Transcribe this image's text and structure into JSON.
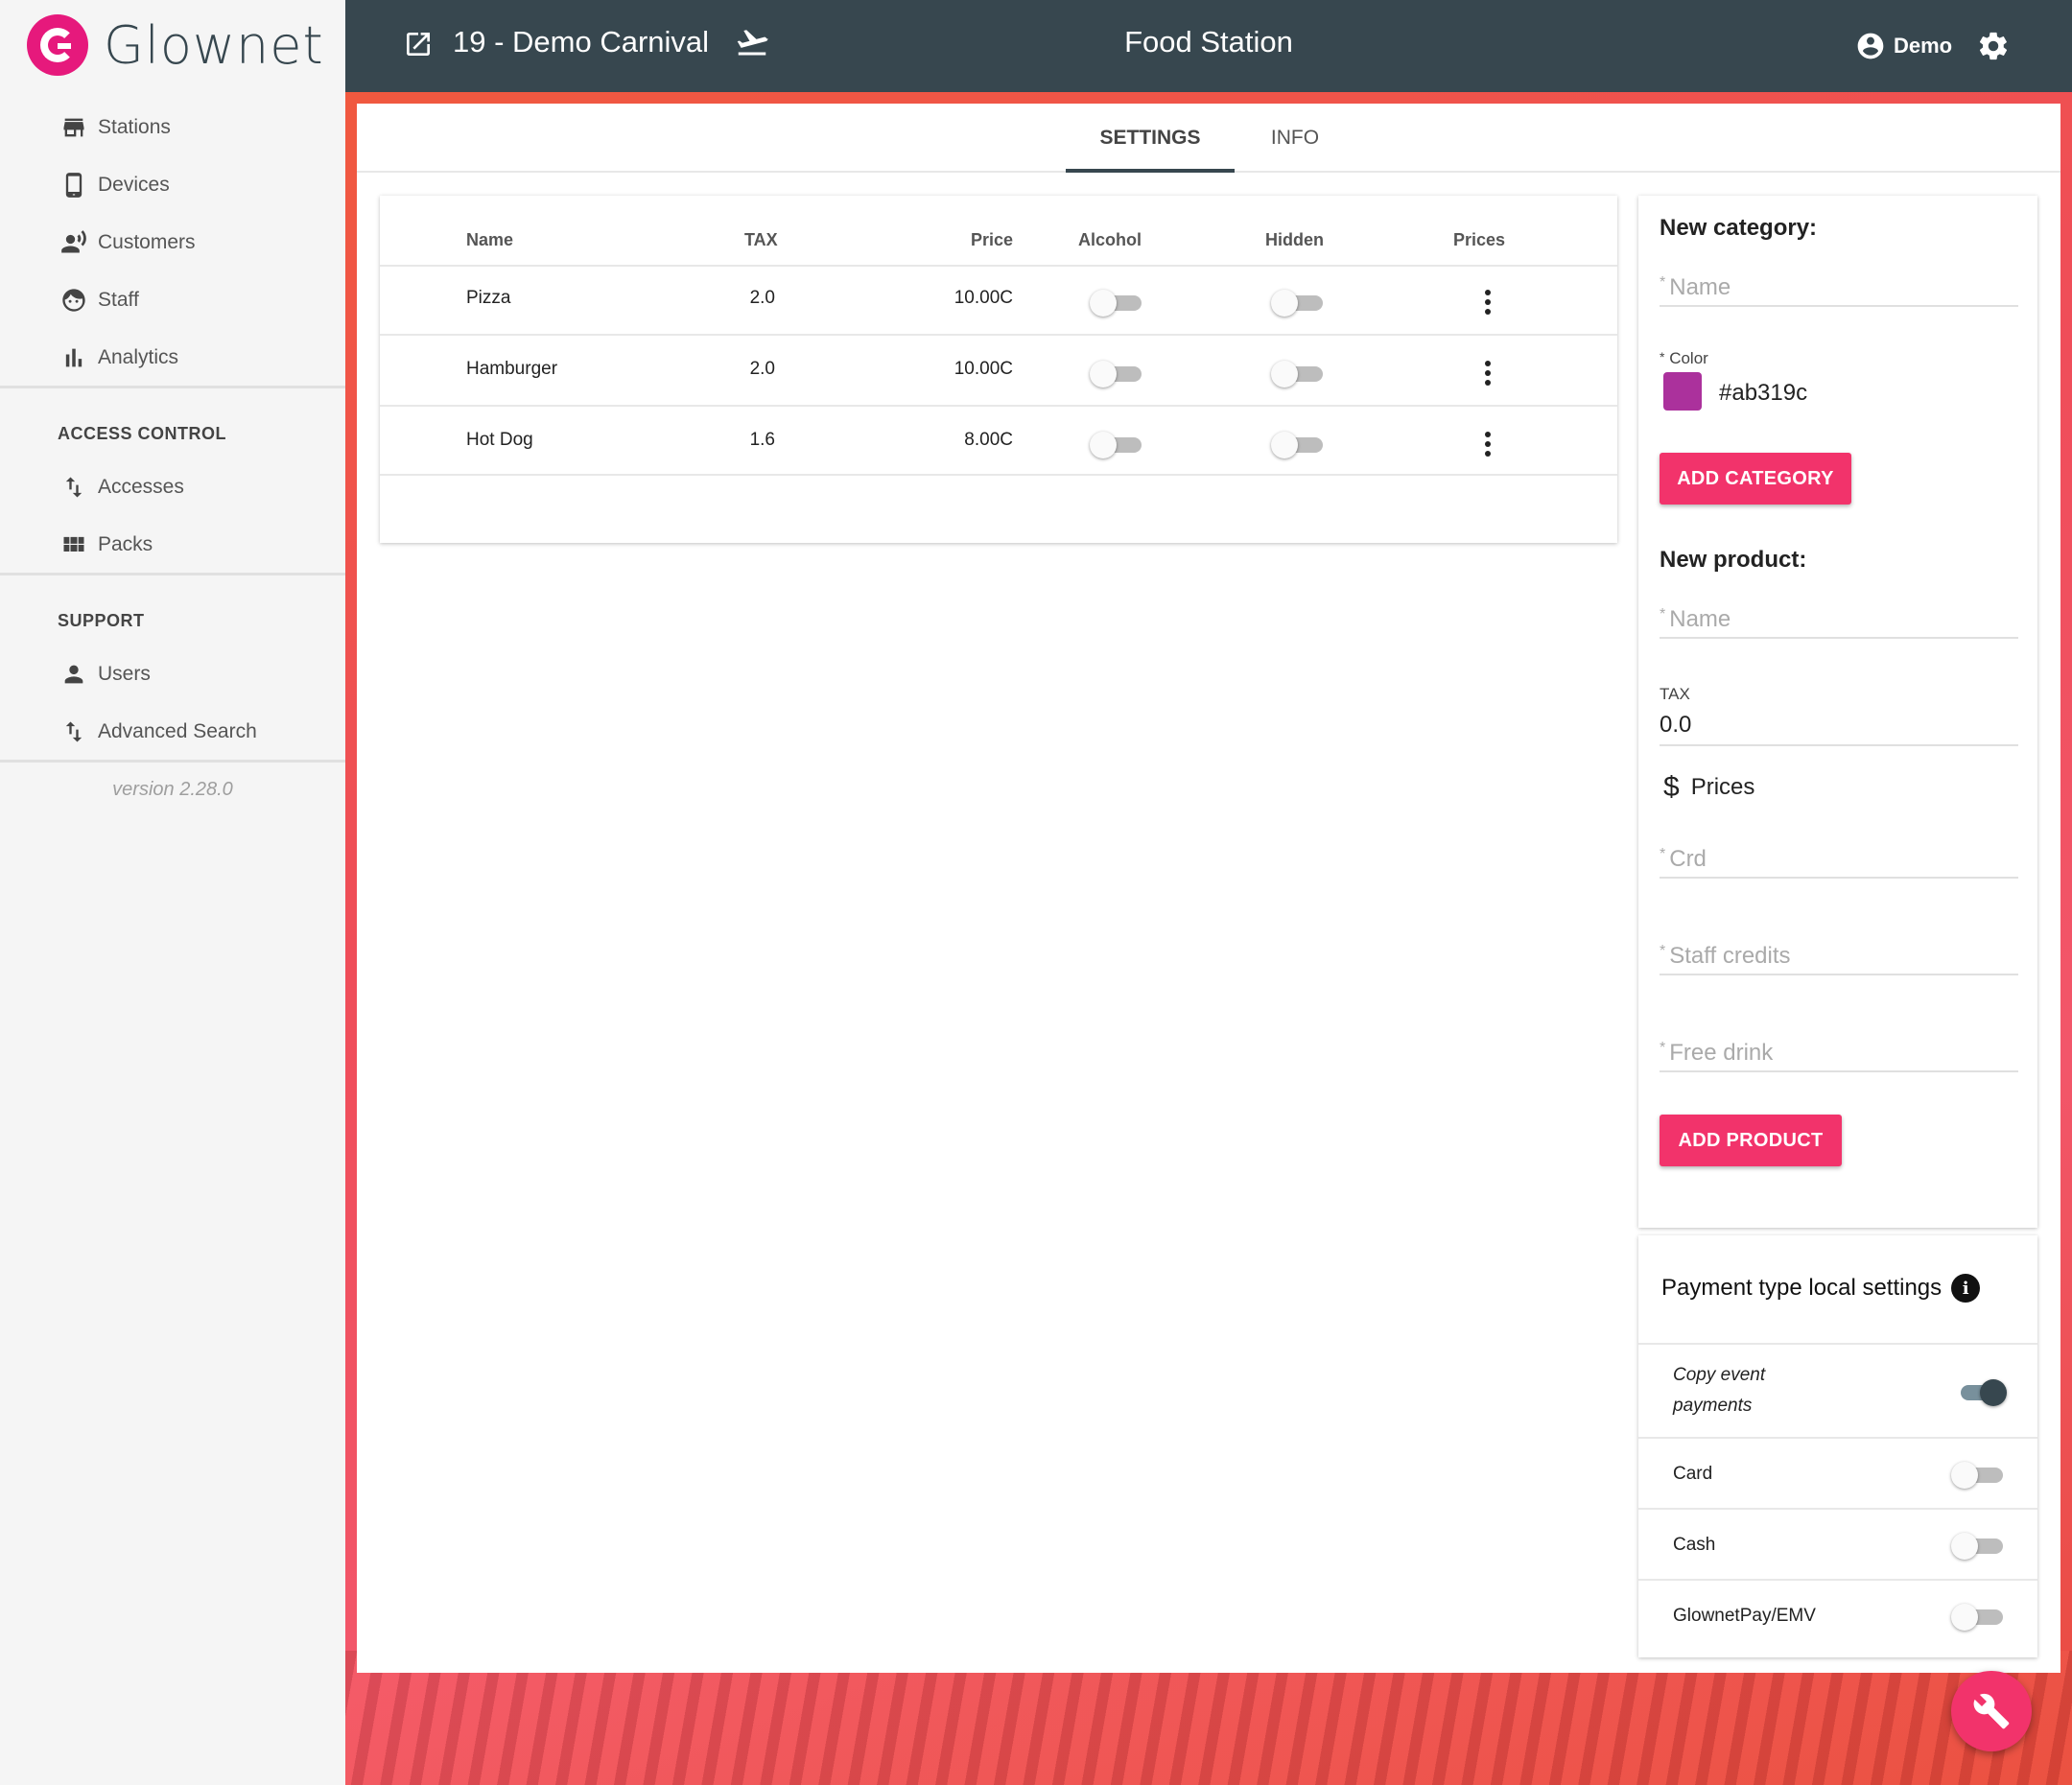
{
  "app": {
    "name": "Glownet",
    "version": "version 2.28.0"
  },
  "sidebar": {
    "items": [
      {
        "label": "Stations",
        "icon": "store-icon"
      },
      {
        "label": "Devices",
        "icon": "phone-icon"
      },
      {
        "label": "Customers",
        "icon": "customer-voice-icon"
      },
      {
        "label": "Staff",
        "icon": "face-icon"
      },
      {
        "label": "Analytics",
        "icon": "bar-chart-icon"
      }
    ],
    "access_control": {
      "heading": "ACCESS CONTROL",
      "items": [
        {
          "label": "Accesses",
          "icon": "swap-vertical-icon"
        },
        {
          "label": "Packs",
          "icon": "grid-icon"
        }
      ]
    },
    "support": {
      "heading": "SUPPORT",
      "items": [
        {
          "label": "Users",
          "icon": "person-icon"
        },
        {
          "label": "Advanced Search",
          "icon": "swap-vertical-icon"
        }
      ]
    }
  },
  "header": {
    "event_title": "19 - Demo Carnival",
    "page_title": "Food Station",
    "user_label": "Demo"
  },
  "tabs": [
    {
      "label": "SETTINGS",
      "active": true
    },
    {
      "label": "INFO",
      "active": false
    }
  ],
  "table": {
    "columns": [
      "Name",
      "TAX",
      "Price",
      "Alcohol",
      "Hidden",
      "Prices"
    ],
    "rows": [
      {
        "name": "Pizza",
        "tax": "2.0",
        "price": "10.00C",
        "alcohol": false,
        "hidden": false
      },
      {
        "name": "Hamburger",
        "tax": "2.0",
        "price": "10.00C",
        "alcohol": false,
        "hidden": false
      },
      {
        "name": "Hot Dog",
        "tax": "1.6",
        "price": "8.00C",
        "alcohol": false,
        "hidden": false
      }
    ]
  },
  "new_category": {
    "heading": "New category:",
    "name_placeholder": "Name",
    "required_mark": "*",
    "color_label": "Color",
    "color_value": "#ab319c",
    "button": "ADD CATEGORY"
  },
  "new_product": {
    "heading": "New product:",
    "name_placeholder": "Name",
    "tax_label": "TAX",
    "tax_value": "0.0",
    "prices_label": "Prices",
    "prices_icon": "$",
    "crd_placeholder": "Crd",
    "staff_credits_placeholder": "Staff credits",
    "free_drink_placeholder": "Free drink",
    "button": "ADD PRODUCT"
  },
  "payment_settings": {
    "title": "Payment type local settings",
    "info_icon": "i",
    "rows": [
      {
        "label_line1": "Copy event",
        "label_line2": "payments",
        "on": true
      },
      {
        "label": "Card",
        "on": false
      },
      {
        "label": "Cash",
        "on": false
      },
      {
        "label": "GlownetPay/EMV",
        "on": false
      }
    ]
  },
  "colors": {
    "accent": "#f2336b",
    "header": "#37474f",
    "brand": "#e6197c",
    "swatch": "#ab319c"
  }
}
